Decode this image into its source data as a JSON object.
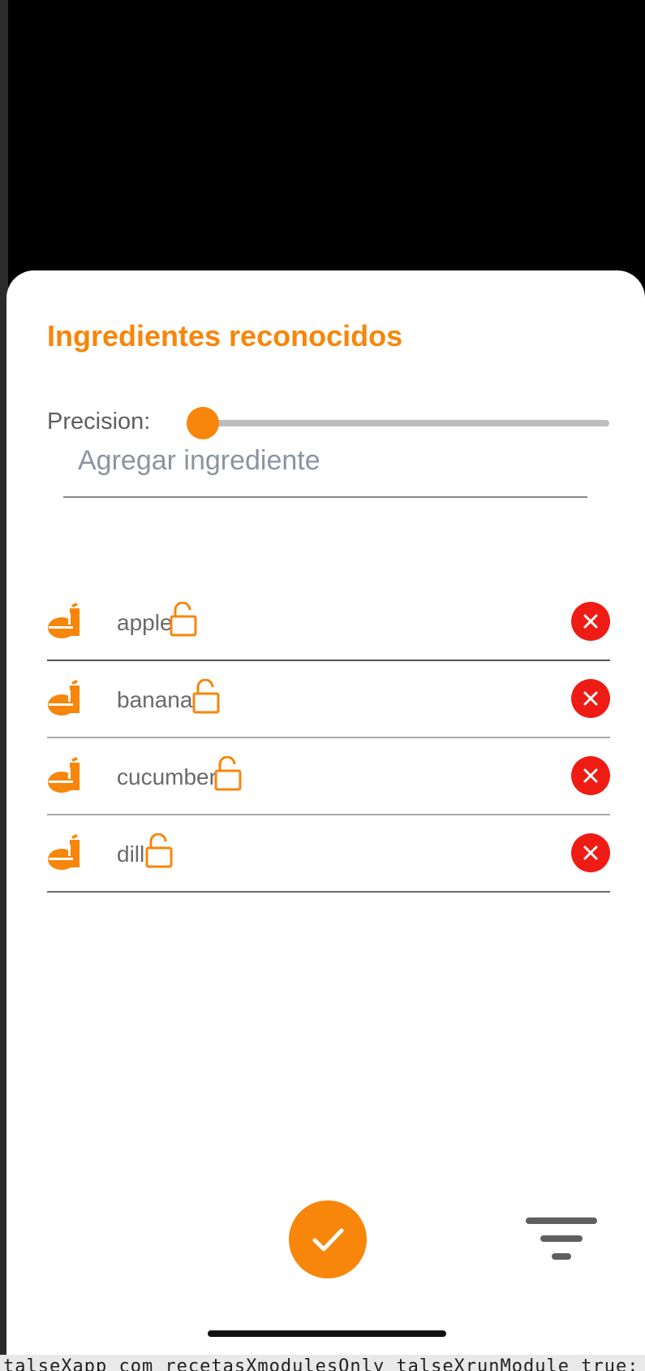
{
  "sheet": {
    "title": "Ingredientes reconocidos",
    "precision_label": "Precision:",
    "precision_value": 0,
    "input_placeholder": "Agregar ingrediente",
    "ingredients": [
      {
        "name": "apple",
        "icon": "food-icon",
        "lock": "unlock-icon"
      },
      {
        "name": "banana",
        "icon": "food-icon",
        "lock": "unlock-icon"
      },
      {
        "name": "cucumber",
        "icon": "food-icon",
        "lock": "unlock-icon"
      },
      {
        "name": "dill",
        "icon": "food-icon",
        "lock": "unlock-icon"
      }
    ]
  },
  "background_text": {
    "bottom_line": "talseXapp com recetasXmodulesOnly talseXrunModule true:"
  },
  "colors": {
    "accent": "#f7860a",
    "remove": "#ee1c14",
    "text_muted": "#6a6a6a"
  }
}
